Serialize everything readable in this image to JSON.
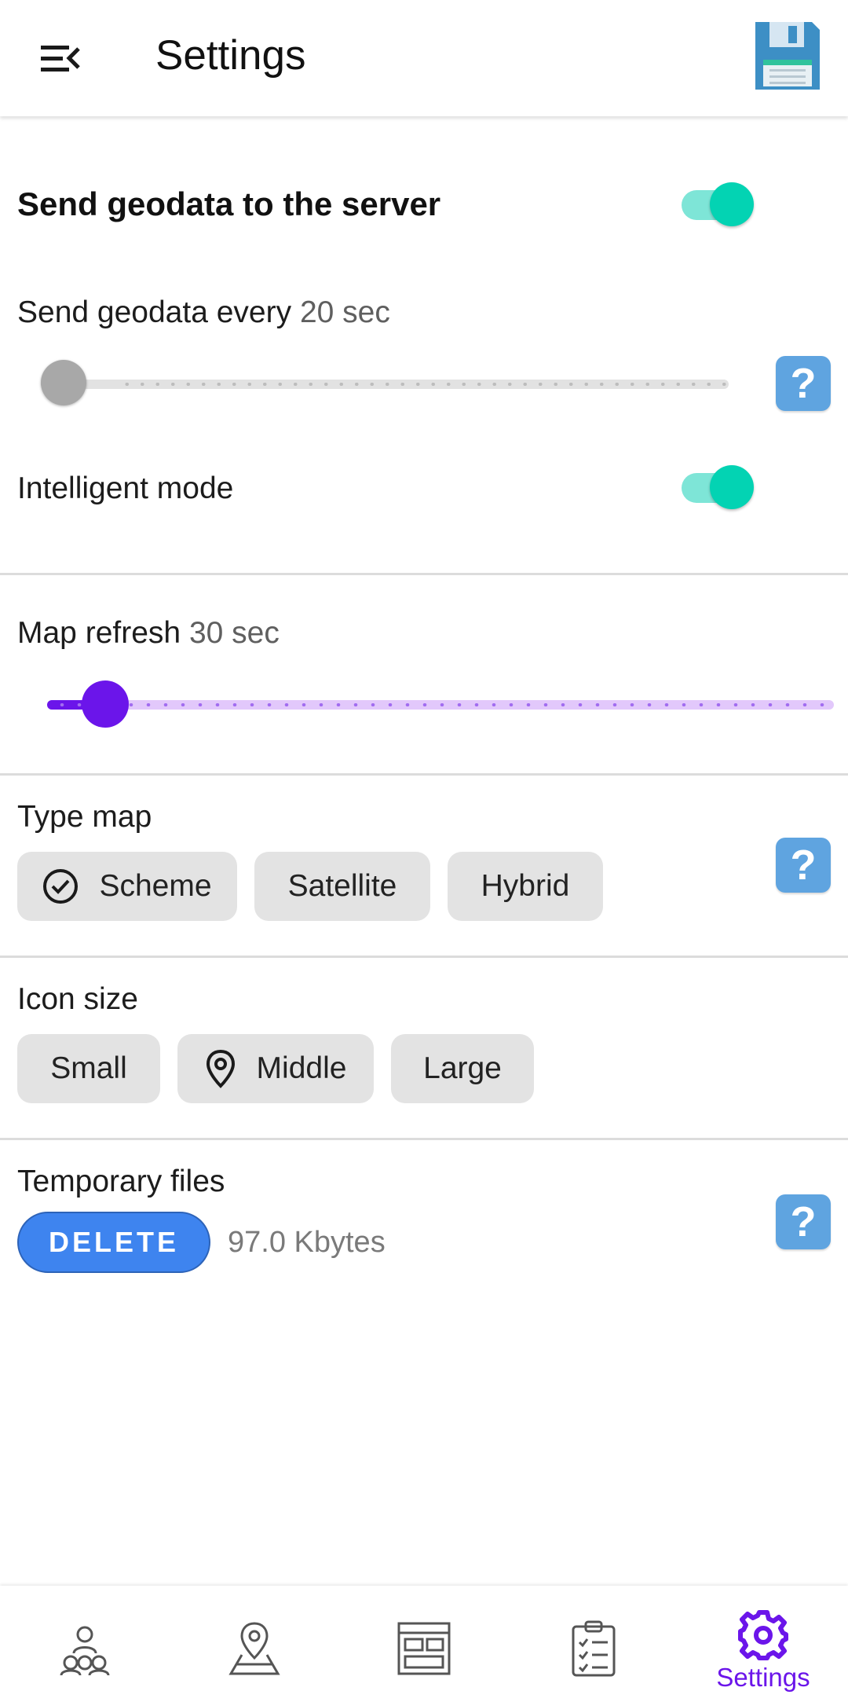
{
  "header": {
    "title": "Settings",
    "menu_icon": "menu-collapse-icon",
    "save_icon": "floppy-disk-icon"
  },
  "geodata": {
    "title": "Send geodata to the server",
    "enabled": true,
    "interval_label": "Send geodata every",
    "interval_value": "20 sec",
    "interval_fraction": 0.0,
    "help_label": "?"
  },
  "intelligent": {
    "label": "Intelligent mode",
    "enabled": true
  },
  "map_refresh": {
    "label": "Map refresh",
    "value": "30 sec",
    "fraction": 0.07
  },
  "type_map": {
    "title": "Type map",
    "options": [
      "Scheme",
      "Satellite",
      "Hybrid"
    ],
    "selected": "Scheme",
    "help_label": "?"
  },
  "icon_size": {
    "title": "Icon size",
    "options": [
      "Small",
      "Middle",
      "Large"
    ],
    "selected": "Middle"
  },
  "temp_files": {
    "title": "Temporary files",
    "delete_label": "DELETE",
    "size": "97.0 Kbytes",
    "help_label": "?"
  },
  "bottom_nav": {
    "items": [
      {
        "icon": "people-group-icon"
      },
      {
        "icon": "map-location-icon"
      },
      {
        "icon": "dashboard-layout-icon"
      },
      {
        "icon": "checklist-icon"
      },
      {
        "icon": "gear-icon",
        "label": "Settings"
      }
    ],
    "active": 4
  },
  "colors": {
    "accent": "#6b15ea",
    "toggle_on": "#03d3b3",
    "help_button": "#5fa4e0",
    "delete_button": "#3e84ef"
  }
}
